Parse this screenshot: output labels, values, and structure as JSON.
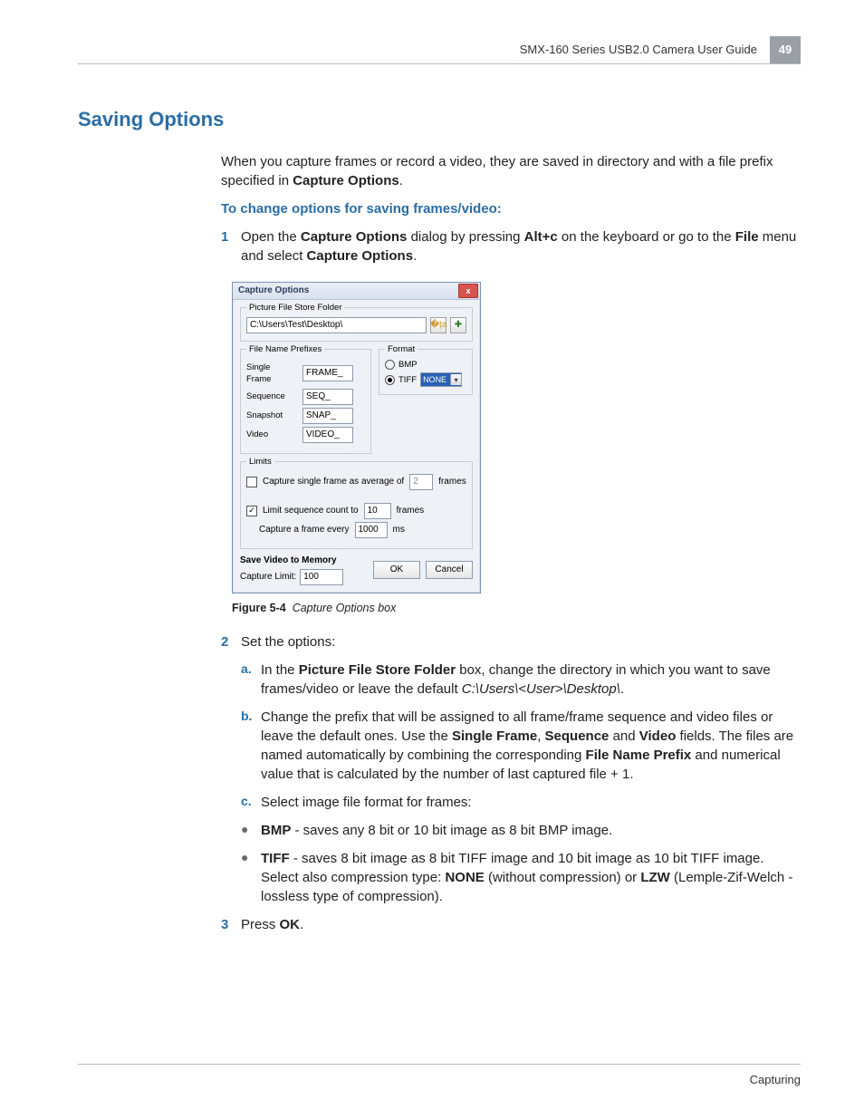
{
  "header": {
    "guide_title": "SMX-160 Series USB2.0 Camera User Guide",
    "page_number": "49"
  },
  "section_title": "Saving Options",
  "intro": {
    "text_before": "When you capture frames or record a video, they are saved in directory and with a file prefix specified in ",
    "bold": "Capture Options",
    "text_after": "."
  },
  "subhead": "To change options for saving frames/video:",
  "steps": {
    "s1": {
      "n": "1",
      "t1": "Open the ",
      "b1": "Capture Options",
      "t2": " dialog by pressing ",
      "b2": "Alt+c",
      "t3": " on the keyboard or go to the ",
      "b3": "File",
      "t4": " menu and select ",
      "b4": "Capture Options",
      "t5": "."
    },
    "s2": {
      "n": "2",
      "t": "Set the options:"
    },
    "s3": {
      "n": "3",
      "t1": "Press ",
      "b1": "OK",
      "t2": "."
    }
  },
  "subs": {
    "a": {
      "n": "a.",
      "t1": "In the ",
      "b1": "Picture File Store Folder",
      "t2": " box, change the directory in which you want to save frames/video or leave the default ",
      "i1": "C:\\Users\\<User>\\Desktop\\",
      "t3": "."
    },
    "b": {
      "n": "b.",
      "t1": "Change the prefix that will be assigned to all frame/frame sequence and video files or leave the default ones. Use the ",
      "b1": "Single Frame",
      "t2": ", ",
      "b2": "Sequence",
      "t3": " and ",
      "b3": "Video",
      "t4": " fields. The files are named automatically by combining the corresponding ",
      "b4": "File Name Prefix",
      "t5": " and numerical value that is calculated by the number of last captured file + 1."
    },
    "c": {
      "n": "c.",
      "t": "Select image file format for frames:"
    }
  },
  "bullets": {
    "bmp": {
      "b": "BMP",
      "t": " - saves any 8 bit or 10 bit image as 8 bit BMP image."
    },
    "tiff": {
      "b": "TIFF",
      "t1": " - saves 8 bit image as 8 bit TIFF image and 10 bit image as 10 bit TIFF image. Select also compression type: ",
      "b2": "NONE",
      "t2": " (without compression) or ",
      "b3": "LZW",
      "t3": " (Lemple-Zif-Welch - lossless type of compression)."
    }
  },
  "figure": {
    "label": "Figure 5-4",
    "caption": "Capture Options box"
  },
  "dialog": {
    "title": "Capture Options",
    "close": "x",
    "grp_store": "Picture File Store Folder",
    "path": "C:\\Users\\Test\\Desktop\\",
    "grp_prefix": "File Name Prefixes",
    "labels": {
      "single": "Single Frame",
      "seq": "Sequence",
      "snap": "Snapshot",
      "video": "Video"
    },
    "values": {
      "single": "FRAME_",
      "seq": "SEQ_",
      "snap": "SNAP_",
      "video": "VIDEO_"
    },
    "grp_format": "Format",
    "formats": {
      "bmp": "BMP",
      "tiff": "TIFF"
    },
    "combo": "NONE",
    "grp_limits": "Limits",
    "avg_label": "Capture single frame as average of",
    "avg_value": "2",
    "avg_unit": "frames",
    "seq_label": "Limit sequence count to",
    "seq_value": "10",
    "seq_unit": "frames",
    "every_label": "Capture a frame every",
    "every_value": "1000",
    "every_unit": "ms",
    "mem_label": "Save Video to Memory",
    "cap_lbl": "Capture Limit:",
    "cap_val": "100",
    "ok": "OK",
    "cancel": "Cancel"
  },
  "footer_section": "Capturing"
}
